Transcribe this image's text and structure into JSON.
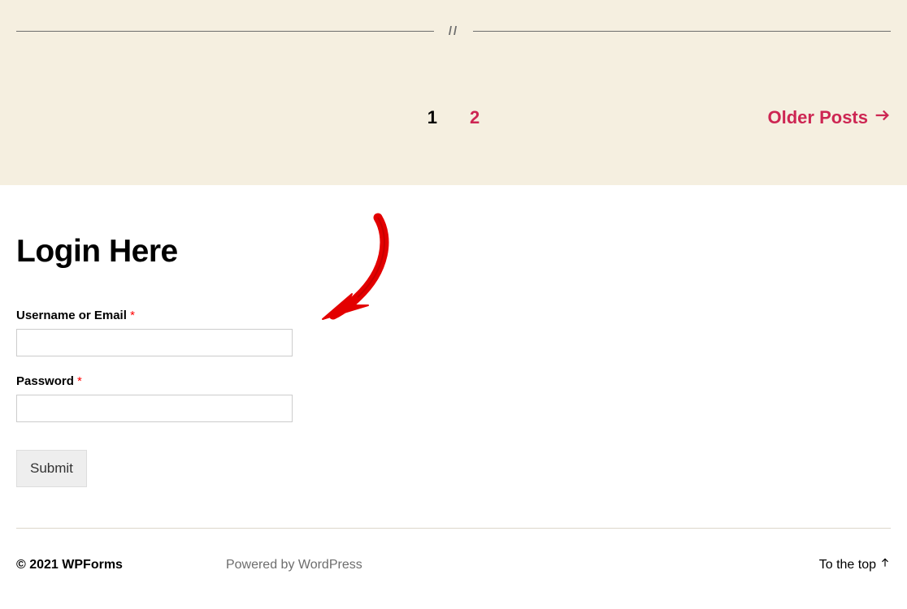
{
  "pagination": {
    "divider_glyph": "//",
    "current_page": "1",
    "page_2": "2",
    "older_posts_label": "Older Posts"
  },
  "login_form": {
    "heading": "Login Here",
    "username_label": "Username or Email",
    "password_label": "Password",
    "required_mark": "*",
    "submit_label": "Submit"
  },
  "footer": {
    "copyright": "© 2021 WPForms",
    "powered_by": "Powered by WordPress",
    "to_top_label": "To the top"
  }
}
